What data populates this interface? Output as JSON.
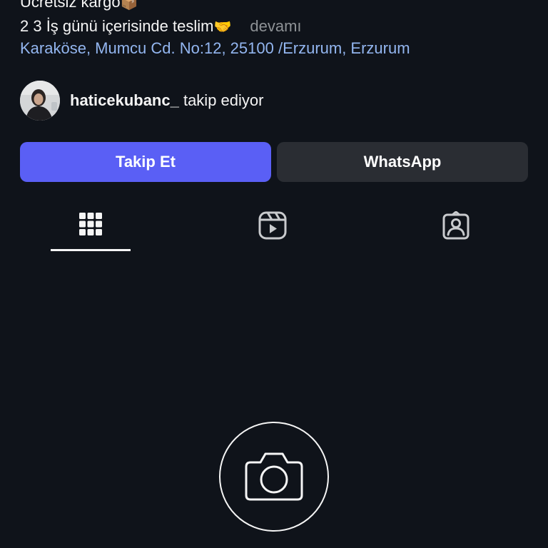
{
  "bio": {
    "line1": "Ücretsiz kargo",
    "line1_emoji": "📦",
    "line2": "2 3 İş günü içerisinde teslim",
    "line2_emoji": "🤝",
    "more_label": "devamı",
    "address": "Karaköse, Mumcu Cd. No:12, 25100 /Erzurum, Erzurum"
  },
  "followed_by": {
    "username": "haticekubanc_",
    "suffix": " takip ediyor"
  },
  "actions": {
    "follow_label": "Takip Et",
    "whatsapp_label": "WhatsApp"
  },
  "tabs": [
    {
      "icon": "grid-icon",
      "active": true
    },
    {
      "icon": "reels-icon",
      "active": false
    },
    {
      "icon": "tagged-icon",
      "active": false
    }
  ],
  "empty_state": {
    "icon": "camera-icon"
  },
  "colors": {
    "background": "#0f131a",
    "primary_button": "#5a5ff5",
    "secondary_button": "#2a2d33",
    "link": "#93b6f0",
    "muted": "#8e9296"
  }
}
